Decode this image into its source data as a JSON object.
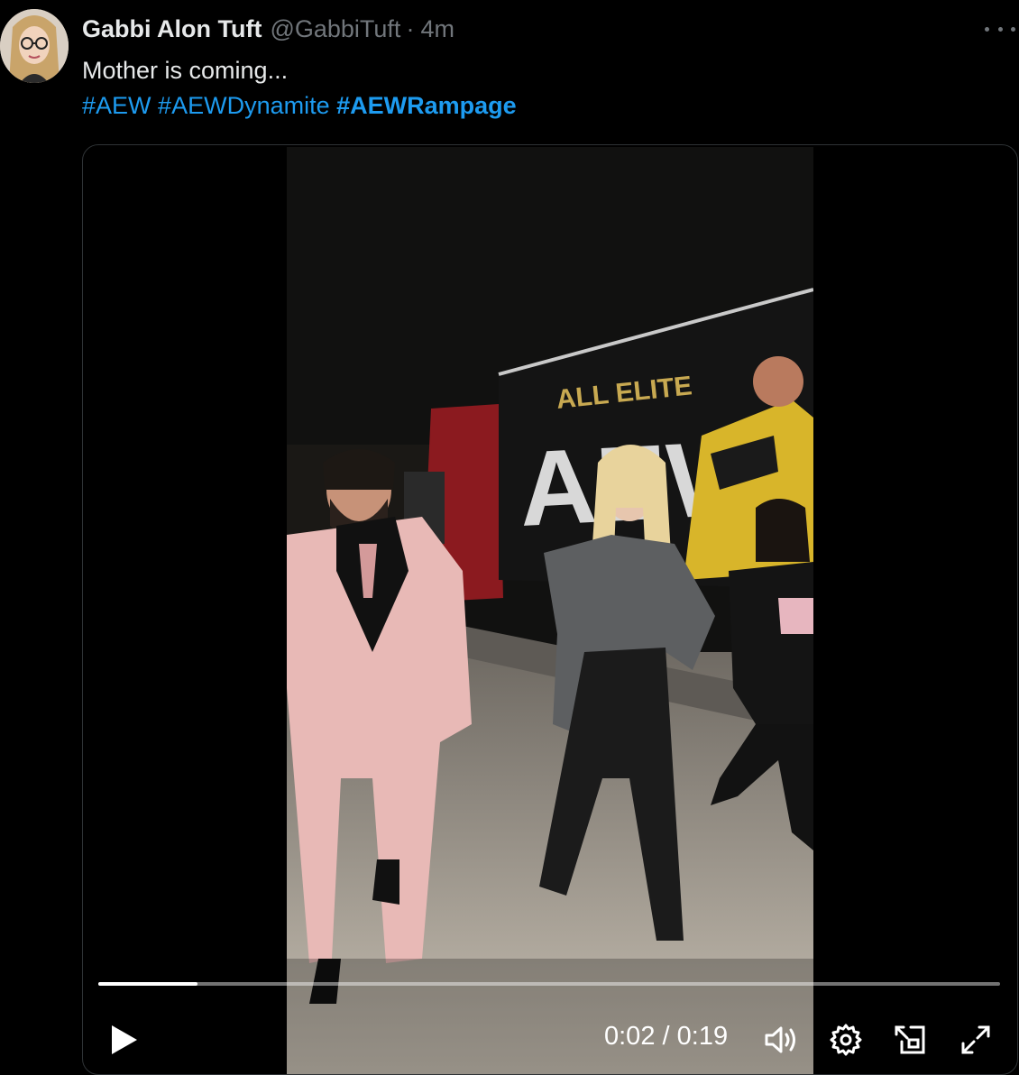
{
  "tweet": {
    "author_name": "Gabbi Alon Tuft",
    "author_handle": "@GabbiTuft",
    "separator": "·",
    "time_ago": "4m",
    "text": "Mother is coming...",
    "hashtags": [
      {
        "text": "#AEW",
        "bold": false
      },
      {
        "text": "#AEWDynamite",
        "bold": false
      },
      {
        "text": "#AEWRampage",
        "bold": true
      }
    ]
  },
  "video": {
    "truck_line1": "ALL ELITE",
    "truck_logo": "AEW",
    "current_time": "0:02",
    "time_sep": "/",
    "duration": "0:19",
    "progress_fraction": 0.11
  },
  "icons": {
    "more": "more-dots-icon",
    "play": "play-icon",
    "volume": "volume-icon",
    "settings": "gear-icon",
    "pip": "picture-in-picture-icon",
    "fullscreen": "fullscreen-icon"
  },
  "colors": {
    "background": "#000000",
    "text": "#e7e9ea",
    "secondary": "#71767b",
    "link": "#1d9bf0"
  }
}
